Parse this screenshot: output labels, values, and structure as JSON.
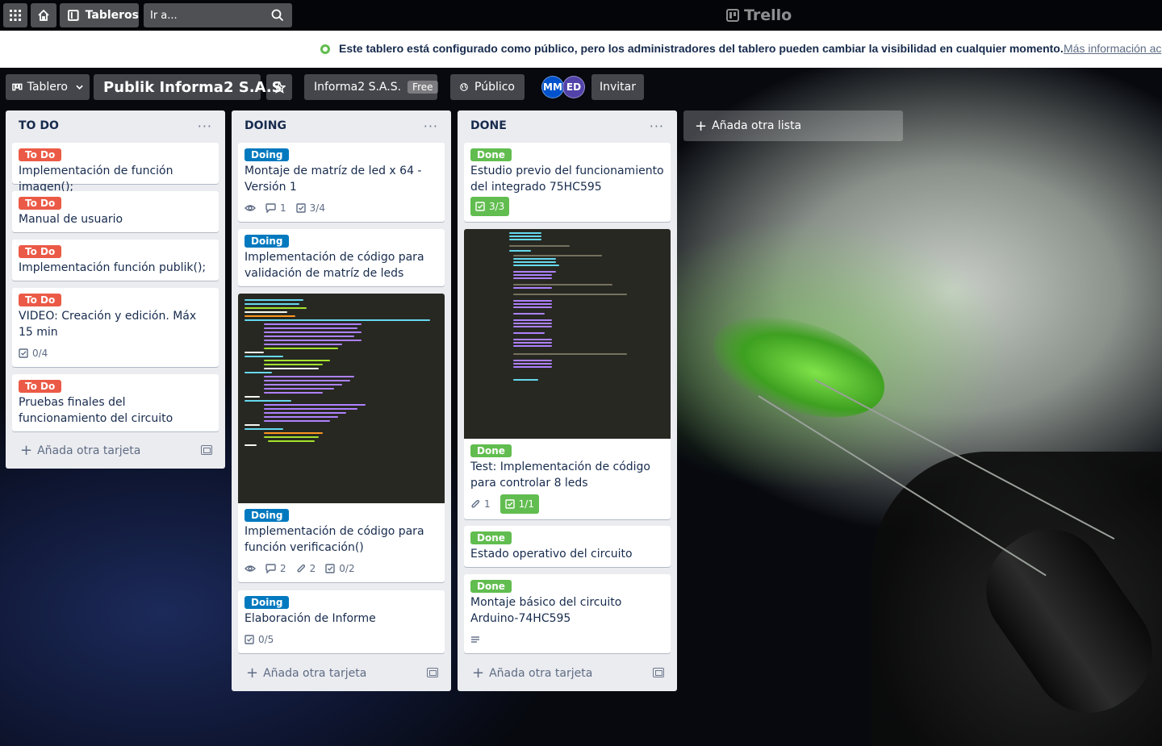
{
  "header": {
    "boards_label": "Tableros",
    "search_placeholder": "Ir a...",
    "logo_text": "Trello"
  },
  "banner": {
    "message": "Este tablero está configurado como público, pero los administradores del tablero pueden cambiar la visibilidad en cualquier momento.",
    "more_link": "Más información ac"
  },
  "board": {
    "view_label": "Tablero",
    "name": "Publik Informa2 S.A.S",
    "team": "Informa2 S.A.S.",
    "team_plan": "Free",
    "visibility": "Público",
    "members": [
      "MM",
      "ED"
    ],
    "invite_label": "Invitar"
  },
  "lists": [
    {
      "title": "TO DO",
      "cards": [
        {
          "label": "To Do",
          "title": "Implementación de función imagen();"
        },
        {
          "label": "To Do",
          "title": "Manual de usuario"
        },
        {
          "label": "To Do",
          "title": "Implementación función publik();"
        },
        {
          "label": "To Do",
          "title": "VIDEO: Creación y edición. Máx 15 min",
          "checklist": "0/4"
        },
        {
          "label": "To Do",
          "title": "Pruebas finales del funcionamiento del circuito"
        }
      ],
      "add_card": "Añada otra tarjeta"
    },
    {
      "title": "DOING",
      "cards": [
        {
          "label": "Doing",
          "title": "Montaje de matríz de led x 64 - Versión 1",
          "comments": "1",
          "checklist": "3/4"
        },
        {
          "label": "Doing",
          "title": "Implementación de código para validación de matríz de leds"
        },
        {
          "label": "Doing",
          "title": "Implementación de código para función verificación()",
          "comments": "2",
          "attachments": "2",
          "checklist": "0/2"
        },
        {
          "label": "Doing",
          "title": "Elaboración de Informe",
          "checklist": "0/5"
        }
      ],
      "add_card": "Añada otra tarjeta"
    },
    {
      "title": "DONE",
      "cards": [
        {
          "label": "Done",
          "title": "Estudio previo del funcionamiento del integrado 75HC595",
          "checklist": "3/3"
        },
        {
          "label": "Done",
          "title": "Test: Implementación de código para controlar 8 leds",
          "attachments": "1",
          "checklist": "1/1"
        },
        {
          "label": "Done",
          "title": "Estado operativo del circuito"
        },
        {
          "label": "Done",
          "title": "Montaje básico del circuito Arduino-74HC595"
        }
      ],
      "add_card": "Añada otra tarjeta"
    }
  ],
  "add_list": "Añada otra lista",
  "colors": {
    "label_todo": "#eb5a46",
    "label_doing": "#0079bf",
    "label_done": "#61bd4f",
    "avatar_mm": "#0052cc",
    "avatar_ed": "#5243aa"
  }
}
